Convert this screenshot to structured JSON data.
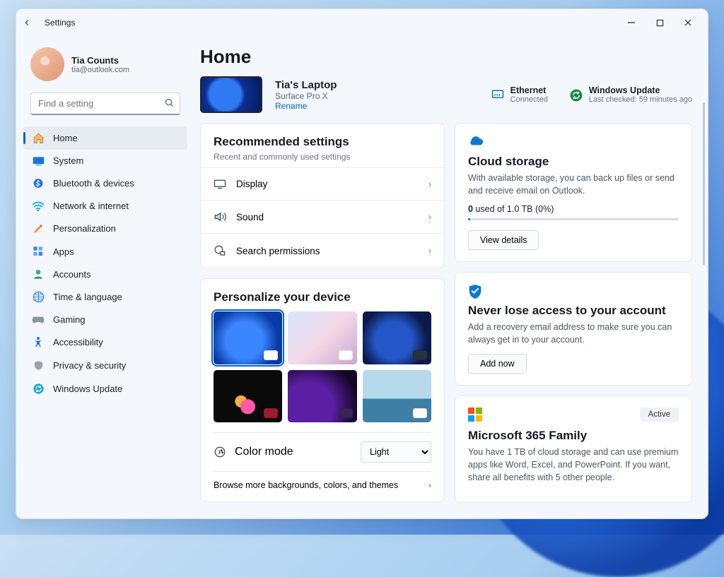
{
  "window": {
    "title": "Settings"
  },
  "user": {
    "name": "Tia Counts",
    "email": "tia@outlook.com"
  },
  "search": {
    "placeholder": "Find a setting"
  },
  "sidebar": {
    "items": [
      {
        "label": "Home"
      },
      {
        "label": "System"
      },
      {
        "label": "Bluetooth & devices"
      },
      {
        "label": "Network & internet"
      },
      {
        "label": "Personalization"
      },
      {
        "label": "Apps"
      },
      {
        "label": "Accounts"
      },
      {
        "label": "Time & language"
      },
      {
        "label": "Gaming"
      },
      {
        "label": "Accessibility"
      },
      {
        "label": "Privacy & security"
      },
      {
        "label": "Windows Update"
      }
    ]
  },
  "main": {
    "heading": "Home",
    "device": {
      "name": "Tia's Laptop",
      "model": "Surface Pro X",
      "rename": "Rename"
    },
    "network": {
      "label": "Ethernet",
      "status": "Connected"
    },
    "update": {
      "label": "Windows Update",
      "status": "Last checked: 59 minutes ago"
    },
    "recommended": {
      "title": "Recommended settings",
      "subtitle": "Recent and commonly used settings",
      "rows": [
        {
          "label": "Display"
        },
        {
          "label": "Sound"
        },
        {
          "label": "Search permissions"
        }
      ]
    },
    "personalize": {
      "title": "Personalize your device",
      "color_mode_label": "Color mode",
      "color_mode_value": "Light",
      "browse": "Browse more backgrounds, colors, and themes"
    },
    "cloud": {
      "title": "Cloud storage",
      "desc": "With available storage, you can back up files or send and receive email on Outlook.",
      "used_num": "0",
      "used_rest": " used of 1.0 TB (0%)",
      "button": "View details"
    },
    "recovery": {
      "title": "Never lose access to your account",
      "desc": "Add a recovery email address to make sure you can always get in to your account.",
      "button": "Add now"
    },
    "m365": {
      "badge": "Active",
      "title": "Microsoft 365 Family",
      "desc": "You have 1 TB of cloud storage and can use premium apps like Word, Excel, and PowerPoint. If you want, share all benefits with 5 other people."
    }
  }
}
